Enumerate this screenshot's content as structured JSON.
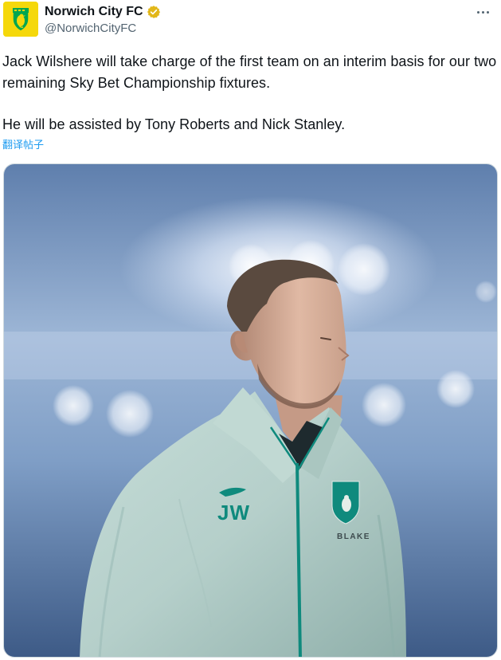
{
  "account": {
    "display_name": "Norwich City FC",
    "handle": "@NorwichCityFC",
    "avatar_icon": "norwich-canary-crest-icon",
    "verified_icon": "gold-verified-badge-icon",
    "brand_yellow": "#f5d80b",
    "brand_green": "#00a650",
    "verified_gold": "#e2b719"
  },
  "menu": {
    "more_icon": "more-dots-icon"
  },
  "tweet": {
    "paragraph_1": "Jack Wilshere will take charge of the first team on an interim basis for our two remaining Sky Bet Championship fixtures.",
    "paragraph_2": "He will be assisted by Tony Roberts and Nick Stanley.",
    "text_color": "#0f1419"
  },
  "translate": {
    "label": "翻译帖子",
    "link_color": "#1d9bf0"
  },
  "media": {
    "jacket_initials": "JW",
    "sponsor_text": "BLAKE",
    "jacket_color": "#b9d3ce",
    "trim_color": "#0f8a7d",
    "background_color": "#7e9cc3"
  }
}
